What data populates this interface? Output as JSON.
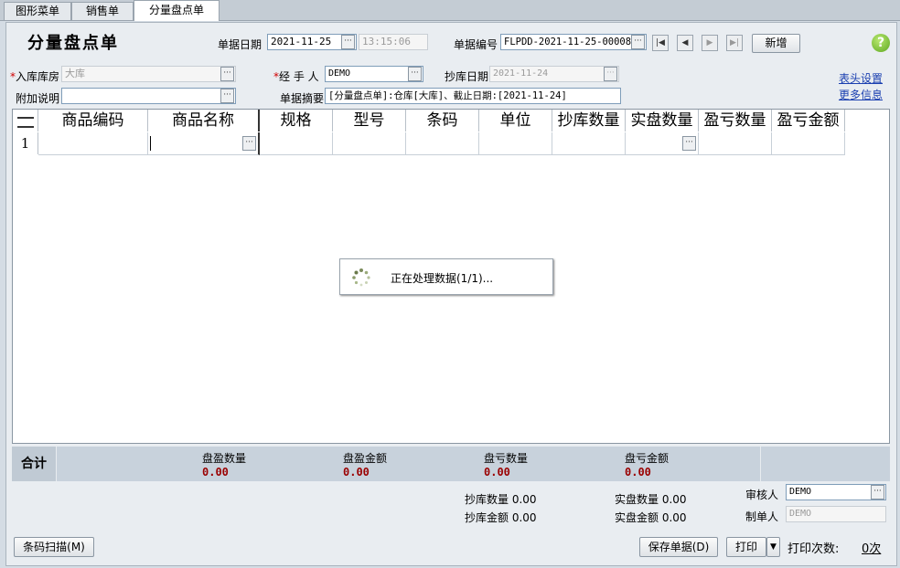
{
  "tabs": [
    "图形菜单",
    "销售单",
    "分量盘点单"
  ],
  "page_title": "分量盘点单",
  "header": {
    "date_label": "单据日期",
    "date_value": "2021-11-25",
    "time_value": "13:15:06",
    "number_label": "单据编号",
    "number_value": "FLPDD-2021-11-25-00008",
    "new_button": "新增",
    "help_icon": "?"
  },
  "form": {
    "required_mark": "*",
    "warehouse_label": "入库库房",
    "warehouse_value": "大库",
    "handler_label": "经 手 人",
    "handler_value": "DEMO",
    "copy_date_label": "抄库日期",
    "copy_date_value": "2021-11-24",
    "remark_label": "附加说明",
    "remark_value": "",
    "summary_label": "单据摘要",
    "summary_value": "[分量盘点单]:仓库[大库]、截止日期:[2021-11-24]"
  },
  "links": {
    "header_settings": "表头设置",
    "more_info": "更多信息"
  },
  "grid": {
    "columns": [
      "商品编码",
      "商品名称",
      "规格",
      "型号",
      "条码",
      "单位",
      "抄库数量",
      "实盘数量",
      "盈亏数量",
      "盈亏金额"
    ],
    "row_number": "1"
  },
  "loading_text": "正在处理数据(1/1)...",
  "totals": {
    "label": "合计",
    "items": [
      {
        "label": "盘盈数量",
        "value": "0.00"
      },
      {
        "label": "盘盈金额",
        "value": "0.00"
      },
      {
        "label": "盘亏数量",
        "value": "0.00"
      },
      {
        "label": "盘亏金额",
        "value": "0.00"
      }
    ]
  },
  "footer": {
    "copy_qty_label": "抄库数量",
    "copy_qty_value": "0.00",
    "copy_amt_label": "抄库金额",
    "copy_amt_value": "0.00",
    "actual_qty_label": "实盘数量",
    "actual_qty_value": "0.00",
    "actual_amt_label": "实盘金额",
    "actual_amt_value": "0.00",
    "reviewer_label": "审核人",
    "reviewer_value": "DEMO",
    "creator_label": "制单人",
    "creator_value": "DEMO",
    "barcode_button": "条码扫描(M)",
    "save_button": "保存单据(D)",
    "print_button": "打印",
    "print_count_label": "打印次数:",
    "print_count_value": "0次"
  },
  "colors": {
    "background": "#d4dce4",
    "frame": "#e9edf1",
    "link": "#1a3fb0",
    "required": "#d00000",
    "total_value": "#9a0000",
    "help_green": "#5ea820"
  }
}
